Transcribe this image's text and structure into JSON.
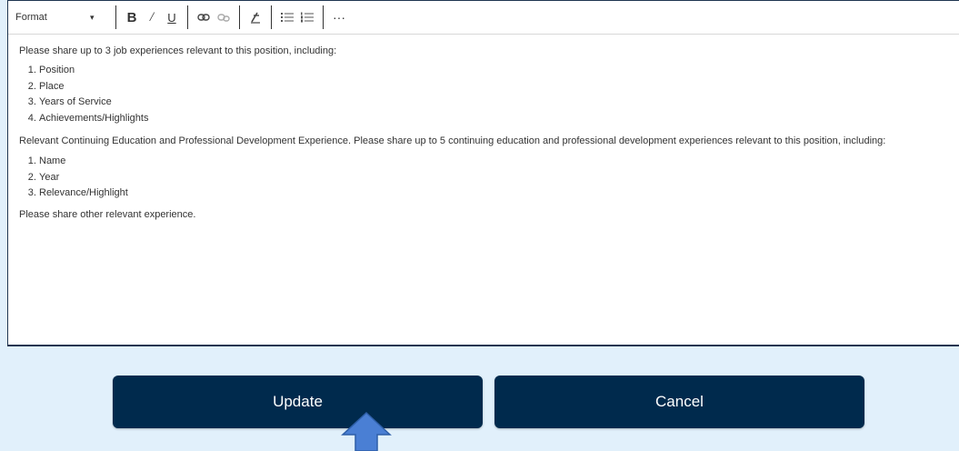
{
  "toolbar": {
    "format_label": "Format",
    "caret": "▾",
    "bold": "B",
    "italic": "/",
    "underline": "U",
    "more": "···"
  },
  "content": {
    "intro": "Please share up to 3 job experiences relevant to this position, including:",
    "job_items": [
      "Position",
      "Place",
      "Years of Service",
      "Achievements/Highlights"
    ],
    "education": "Relevant Continuing Education and Professional Development Experience. Please share up to 5 continuing education and professional development experiences relevant to this position, including:",
    "education_items": [
      "Name",
      "Year",
      "Relevance/Highlight"
    ],
    "other": "Please share other relevant experience."
  },
  "buttons": {
    "update": "Update",
    "cancel": "Cancel"
  },
  "colors": {
    "button_bg": "#002a4d",
    "page_bg": "#e1f0fb",
    "arrow": "#4a7fd4"
  }
}
